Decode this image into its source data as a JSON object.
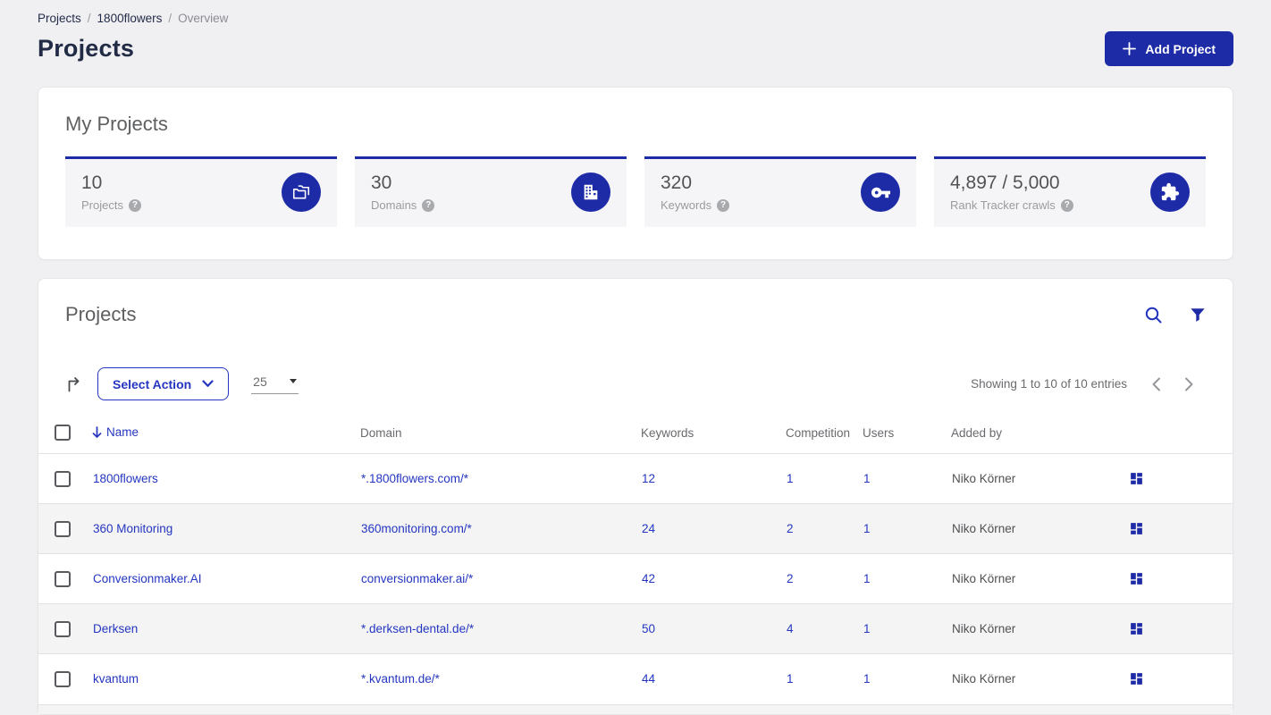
{
  "header": {
    "breadcrumb": [
      "Projects",
      "1800flowers",
      "Overview"
    ],
    "breadcrumb_separator": "/",
    "title": "Projects",
    "add_project": {
      "label": "Add Project",
      "icon": "plus-icon"
    }
  },
  "colors": {
    "brand_blue": "#1d2ba6",
    "link_blue": "#2436c0",
    "navy_text": "#222b45",
    "page_bg": "#f0f0f2",
    "tile_bg": "#f5f5f7",
    "zebra_row": "#f4f4f5"
  },
  "my_projects": {
    "title": "My Projects",
    "help_glyph": "?",
    "tiles": [
      {
        "value": "10",
        "label": "Projects",
        "icon": "folders-icon"
      },
      {
        "value": "30",
        "label": "Domains",
        "icon": "building-icon"
      },
      {
        "value": "320",
        "label": "Keywords",
        "icon": "key-icon"
      },
      {
        "value": "4,897 / 5,000",
        "label": "Rank Tracker crawls",
        "icon": "puzzle-icon"
      }
    ]
  },
  "projects_table": {
    "title": "Projects",
    "header_icons": [
      "search-icon",
      "filter-icon"
    ],
    "toolbar": {
      "export_icon": "export-arrow-icon",
      "select_action_label": "Select Action",
      "page_size": "25",
      "showing_text": "Showing 1 to 10 of 10 entries"
    },
    "columns": {
      "name": "Name",
      "domain": "Domain",
      "keywords": "Keywords",
      "competition": "Competition",
      "users": "Users",
      "added_by": "Added by"
    },
    "sorted_column": "name",
    "row_action_icon": "dashboard-grid-icon",
    "rows": [
      {
        "name": "1800flowers",
        "domain": "*.1800flowers.com/*",
        "keywords": "12",
        "competition": "1",
        "users": "1",
        "added_by": "Niko Körner"
      },
      {
        "name": "360 Monitoring",
        "domain": "360monitoring.com/*",
        "keywords": "24",
        "competition": "2",
        "users": "1",
        "added_by": "Niko Körner"
      },
      {
        "name": "Conversionmaker.AI",
        "domain": "conversionmaker.ai/*",
        "keywords": "42",
        "competition": "2",
        "users": "1",
        "added_by": "Niko Körner"
      },
      {
        "name": "Derksen",
        "domain": "*.derksen-dental.de/*",
        "keywords": "50",
        "competition": "4",
        "users": "1",
        "added_by": "Niko Körner"
      },
      {
        "name": "kvantum",
        "domain": "*.kvantum.de/*",
        "keywords": "44",
        "competition": "1",
        "users": "1",
        "added_by": "Niko Körner"
      }
    ]
  }
}
